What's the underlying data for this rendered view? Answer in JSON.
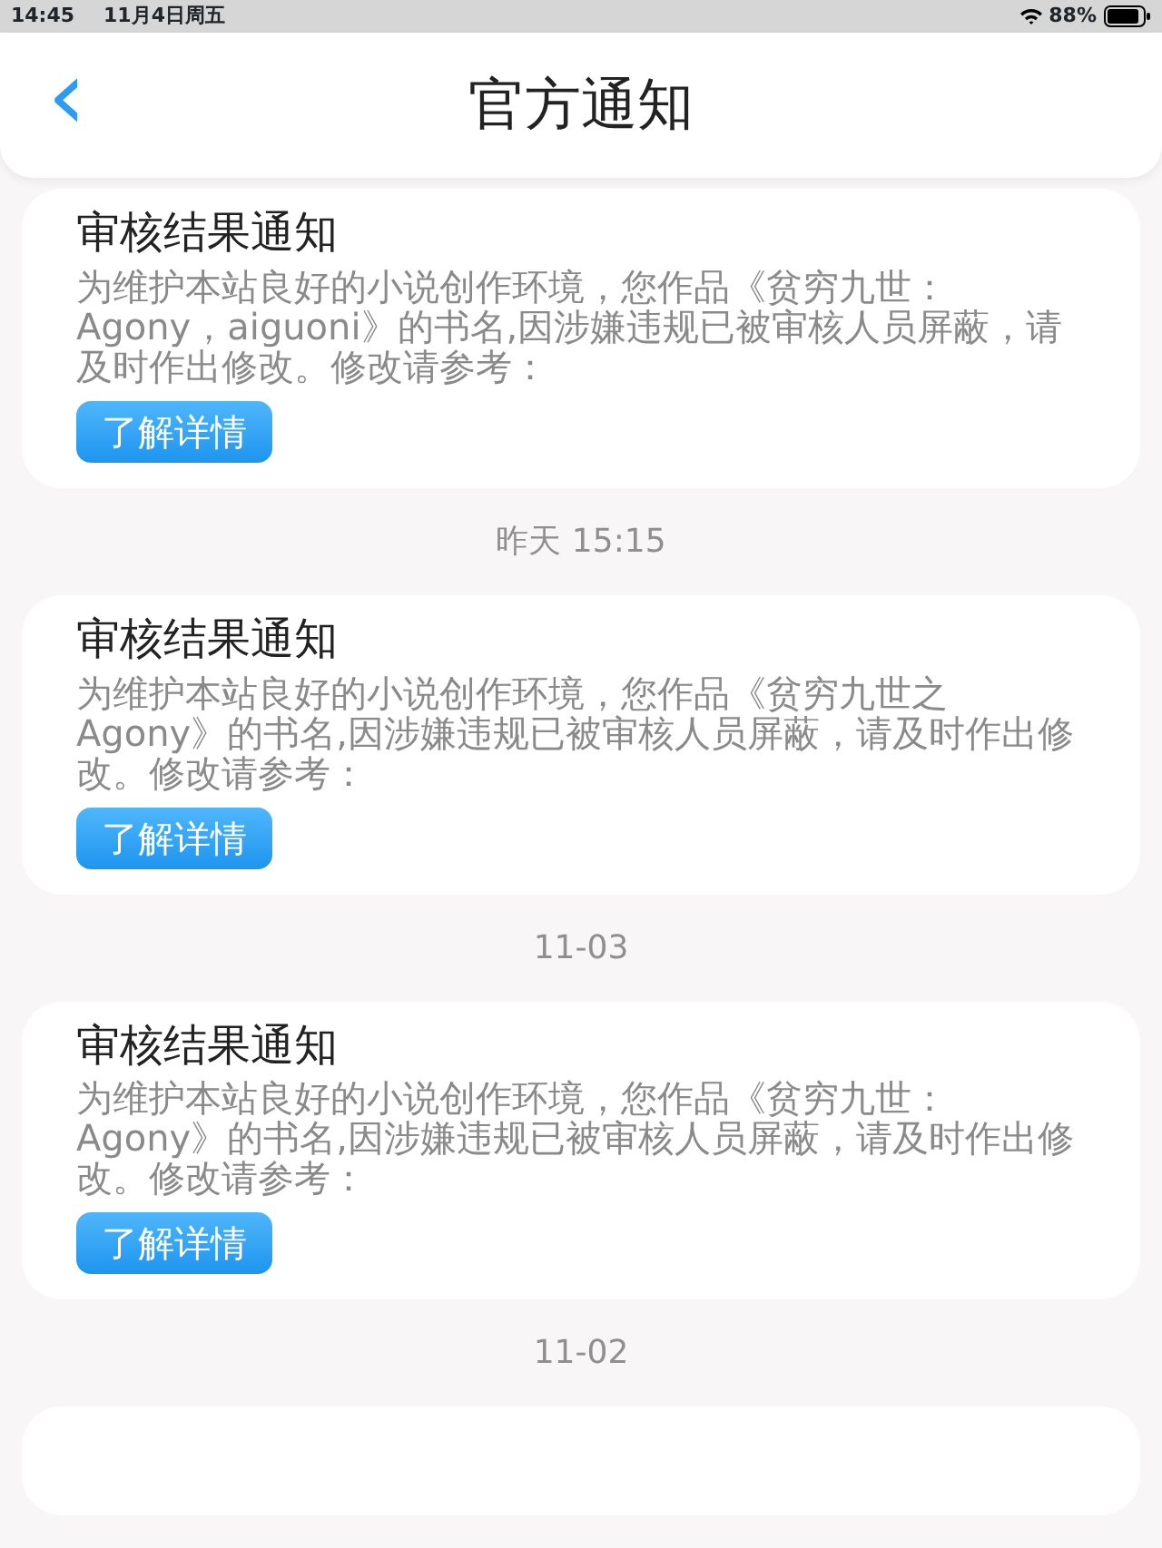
{
  "status_bar": {
    "time": "14:45",
    "date": "11月4日周五",
    "battery": "88%"
  },
  "header": {
    "back": "‹",
    "title": "官方通知"
  },
  "feed": [
    {
      "kind": "notice",
      "title": "审核结果通知",
      "body": "为维护本站良好的小说创作环境，您作品《贫穷九世：Agony，aiguoni》的书名,因涉嫌违规已被审核人员屏蔽，请及时作出修改。修改请参考：",
      "button": "了解详情"
    },
    {
      "kind": "time",
      "text": "昨天 15:15"
    },
    {
      "kind": "notice",
      "title": "审核结果通知",
      "body": "为维护本站良好的小说创作环境，您作品《贫穷九世之Agony》的书名,因涉嫌违规已被审核人员屏蔽，请及时作出修改。修改请参考：",
      "button": "了解详情"
    },
    {
      "kind": "time",
      "text": "11-03"
    },
    {
      "kind": "notice",
      "title": "审核结果通知",
      "body": "为维护本站良好的小说创作环境，您作品《贫穷九世：Agony》的书名,因涉嫌违规已被审核人员屏蔽，请及时作出修改。修改请参考：",
      "button": "了解详情"
    },
    {
      "kind": "time",
      "text": "11-02"
    },
    {
      "kind": "blank"
    }
  ]
}
